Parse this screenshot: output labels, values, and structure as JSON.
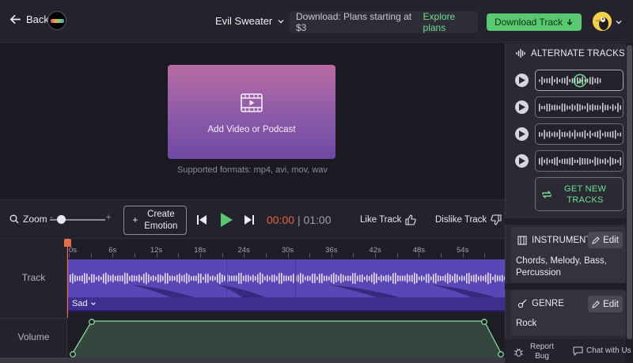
{
  "topbar": {
    "back_label": "Back",
    "track_title": "Evil Sweater",
    "plans_text": "Download: Plans starting at $3",
    "plans_link": "Explore plans",
    "download_label": "Download Track",
    "accent_green": "#58c96f"
  },
  "preview": {
    "add_label": "Add Video or Podcast",
    "formats": "Supported formats: mp4, avi, mov, wav"
  },
  "controls": {
    "zoom_label": "Zoom",
    "zoom_minus": "-",
    "zoom_plus": "+",
    "zoom_level": 0.2,
    "create_emotion_line1": "Create",
    "create_emotion_line2": "Emotion",
    "create_plus": "+",
    "time_current": "00:00",
    "time_separator": "|",
    "time_total": "01:00",
    "like_label": "Like Track",
    "dislike_label": "Dislike Track"
  },
  "timeline": {
    "track_label": "Track",
    "volume_label": "Volume",
    "ticks": [
      "0s",
      "6s",
      "12s",
      "18s",
      "24s",
      "30s",
      "36s",
      "42s",
      "48s",
      "54s"
    ],
    "emotion": "Sad",
    "track_color": "#5b46b8",
    "playhead_color": "#e86d4b"
  },
  "panel": {
    "alternate_header": "ALTERNATE TRACKS",
    "alternate_count": 4,
    "selected_index": 0,
    "new_tracks_line1": "GET NEW",
    "new_tracks_line2": "TRACKS",
    "instruments_header": "INSTRUMENTS",
    "instruments_value": "Chords, Melody, Bass, Percussion",
    "genre_header": "GENRE",
    "genre_value": "Rock",
    "edit_label": "Edit",
    "report_line1": "Report",
    "report_line2": "Bug",
    "chat_label": "Chat with Us"
  }
}
